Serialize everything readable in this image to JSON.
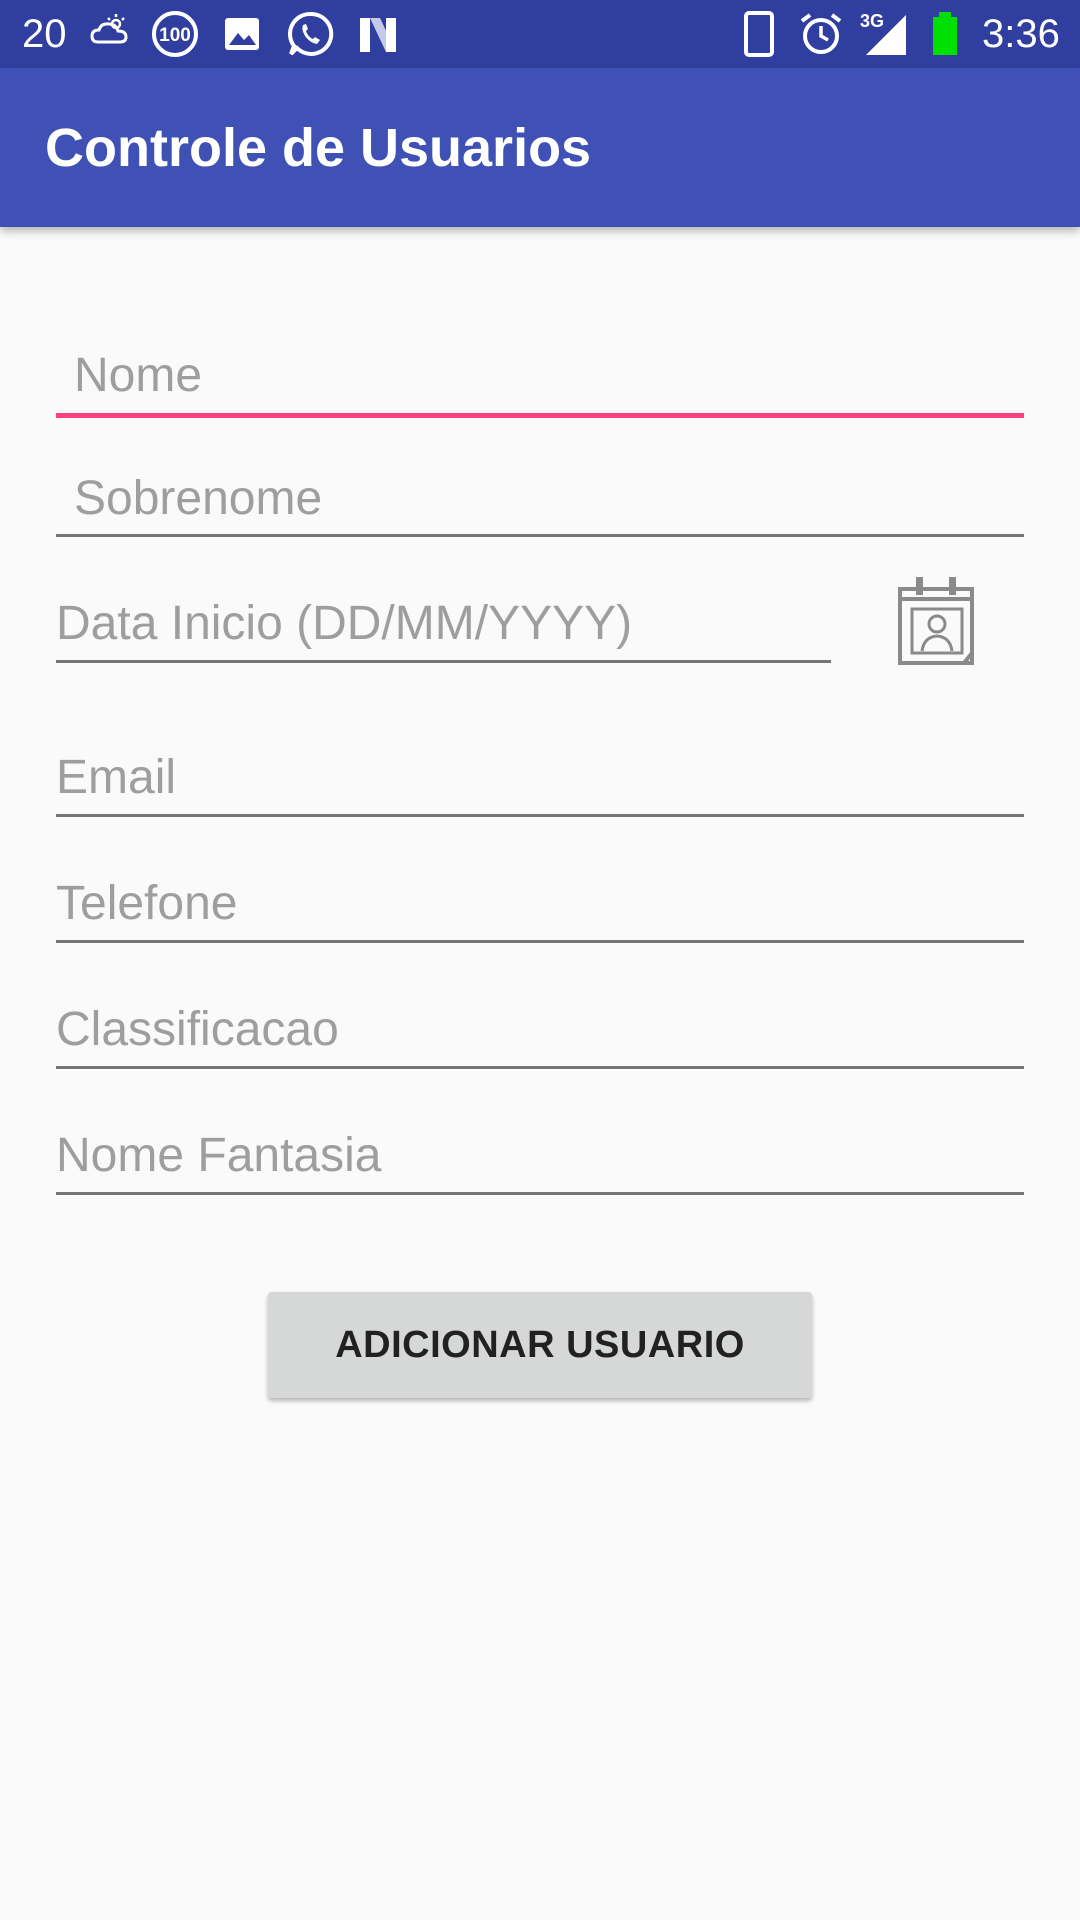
{
  "status_bar": {
    "notification_count": "20",
    "clock": "3:36",
    "network": "3G",
    "icons": [
      "weather-icon",
      "badge-100-icon",
      "image-icon",
      "whatsapp-icon",
      "n-icon",
      "phone-icon",
      "alarm-icon",
      "signal-icon",
      "battery-icon"
    ],
    "battery_color": "#00e000"
  },
  "app_bar": {
    "title": "Controle de Usuarios",
    "color": "#3f51b5"
  },
  "form": {
    "nome": {
      "placeholder": "Nome",
      "value": ""
    },
    "sobrenome": {
      "placeholder": "Sobrenome",
      "value": ""
    },
    "data_inicio": {
      "placeholder": "Data Inicio (DD/MM/YYYY)",
      "value": ""
    },
    "email": {
      "placeholder": "Email",
      "value": ""
    },
    "telefone": {
      "placeholder": "Telefone",
      "value": ""
    },
    "classificacao": {
      "placeholder": "Classificacao",
      "value": ""
    },
    "nome_fantasia": {
      "placeholder": "Nome Fantasia",
      "value": ""
    },
    "calendar_icon": "calendar-contact-icon",
    "focus_color": "#ff4081",
    "submit_label": "ADICIONAR USUARIO"
  }
}
